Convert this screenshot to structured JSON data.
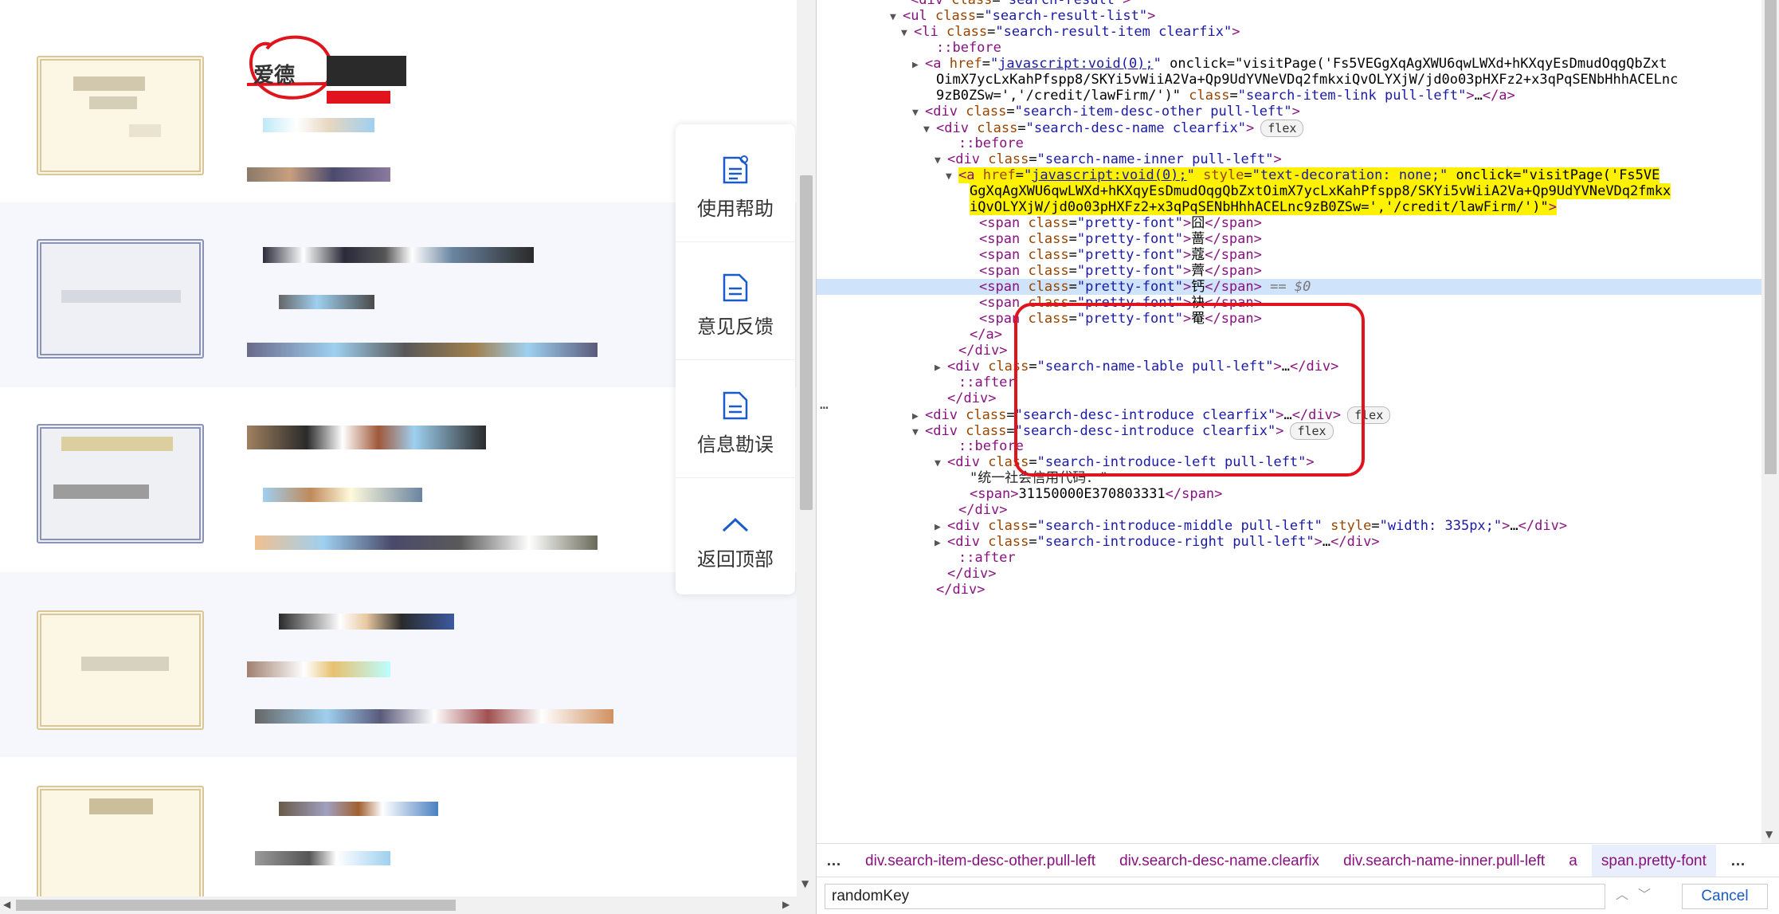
{
  "left_page": {
    "first_result_title": "爱德",
    "side_panel": {
      "items": [
        {
          "label": "使用帮助",
          "icon": "help-doc-icon"
        },
        {
          "label": "意见反馈",
          "icon": "feedback-doc-icon"
        },
        {
          "label": "信息勘误",
          "icon": "correction-doc-icon"
        },
        {
          "label": "返回顶部",
          "icon": "chevron-up-icon"
        }
      ]
    }
  },
  "devtools": {
    "dom_lines": [
      {
        "t": "<div class=\"search-result\">"
      },
      {
        "t": "<ul class=\"search-result-list\">"
      },
      {
        "t": "<li class=\"search-result-item clearfix\">"
      },
      {
        "t": "::before"
      },
      {
        "t": "<a href=\"javascript:void(0);\" onclick=\"visitPage('Fs5VEGgXqAgXWU6qwLWXd+hKXqyEsDmudOqgQbZxt"
      },
      {
        "t": "OimX7ycLxKahPfspp8/SKYi5vWiiA2Va+Qp9UdYVNeVDq2fmkxiQvOLYXjW/jd0o03pHXFz2+x3qPqSENbHhhACELnc"
      },
      {
        "t": "9zB0ZSw=','/credit/lawFirm/')\" class=\"search-item-link pull-left\">…</a>"
      },
      {
        "t": "<div class=\"search-item-desc-other pull-left\">"
      },
      {
        "t": "<div class=\"search-desc-name clearfix\">",
        "badge": "flex"
      },
      {
        "t": "::before"
      },
      {
        "t": "<div class=\"search-name-inner pull-left\">"
      },
      {
        "t": "<a href=\"javascript:void(0);\" style=\"text-decoration: none;\" onclick=\"visitPage('Fs5VE"
      },
      {
        "t": "GgXqAgXWU6qwLWXd+hKXqyEsDmudOqgQbZxtOimX7ycLxKahPfspp8/SKYi5vWiiA2Va+Qp9UdYVNeVDq2fmkx"
      },
      {
        "t": "iQvOLYXjW/jd0o03pHXFz2+x3qPqSENbHhhACELnc9zB0ZSw=','/credit/lawFirm/')\">"
      },
      {
        "t": "<span class=\"pretty-font\">囧</span>"
      },
      {
        "t": "<span class=\"pretty-font\">蔷</span>"
      },
      {
        "t": "<span class=\"pretty-font\">蔻</span>"
      },
      {
        "t": "<span class=\"pretty-font\">薺</span>"
      },
      {
        "t": "<span class=\"pretty-font\">钙</span>",
        "suffix": " == $0"
      },
      {
        "t": "<span class=\"pretty-font\">袂</span>"
      },
      {
        "t": "<span class=\"pretty-font\">罨</span>"
      },
      {
        "t": "</a>"
      },
      {
        "t": "</div>"
      },
      {
        "t": "<div class=\"search-name-lable pull-left\">…</div>"
      },
      {
        "t": "::after"
      },
      {
        "t": "</div>"
      },
      {
        "t": "<div class=\"search-desc-introduce clearfix\">…</div>",
        "badge": "flex"
      },
      {
        "t": "<div class=\"search-desc-introduce clearfix\">",
        "badge": "flex"
      },
      {
        "t": "::before"
      },
      {
        "t": "<div class=\"search-introduce-left pull-left\">"
      },
      {
        "t": "\"统一社会信用代码：\""
      },
      {
        "t": "<span>31150000E370803331</span>"
      },
      {
        "t": "</div>"
      },
      {
        "t": "<div class=\"search-introduce-middle pull-left\" style=\"width: 335px;\">…</div>"
      },
      {
        "t": "<div class=\"search-introduce-right pull-left\">…</div>"
      },
      {
        "t": "::after"
      },
      {
        "t": "</div>"
      },
      {
        "t": "</div>"
      }
    ],
    "breadcrumbs": {
      "ellipsis": "…",
      "items": [
        "div.search-item-desc-other.pull-left",
        "div.search-desc-name.clearfix",
        "div.search-name-inner.pull-left",
        "a",
        "span.pretty-font"
      ],
      "more": "…"
    },
    "search": {
      "value": "randomKey",
      "cancel_label": "Cancel"
    },
    "gutter_dots": "…"
  },
  "colors": {
    "highlight_yellow": "#fff200",
    "annotation_red": "#e1141e",
    "selected_row": "#cfe3fb",
    "tag": "#881280",
    "attr_name": "#994500",
    "attr_value": "#1a1aa6"
  }
}
